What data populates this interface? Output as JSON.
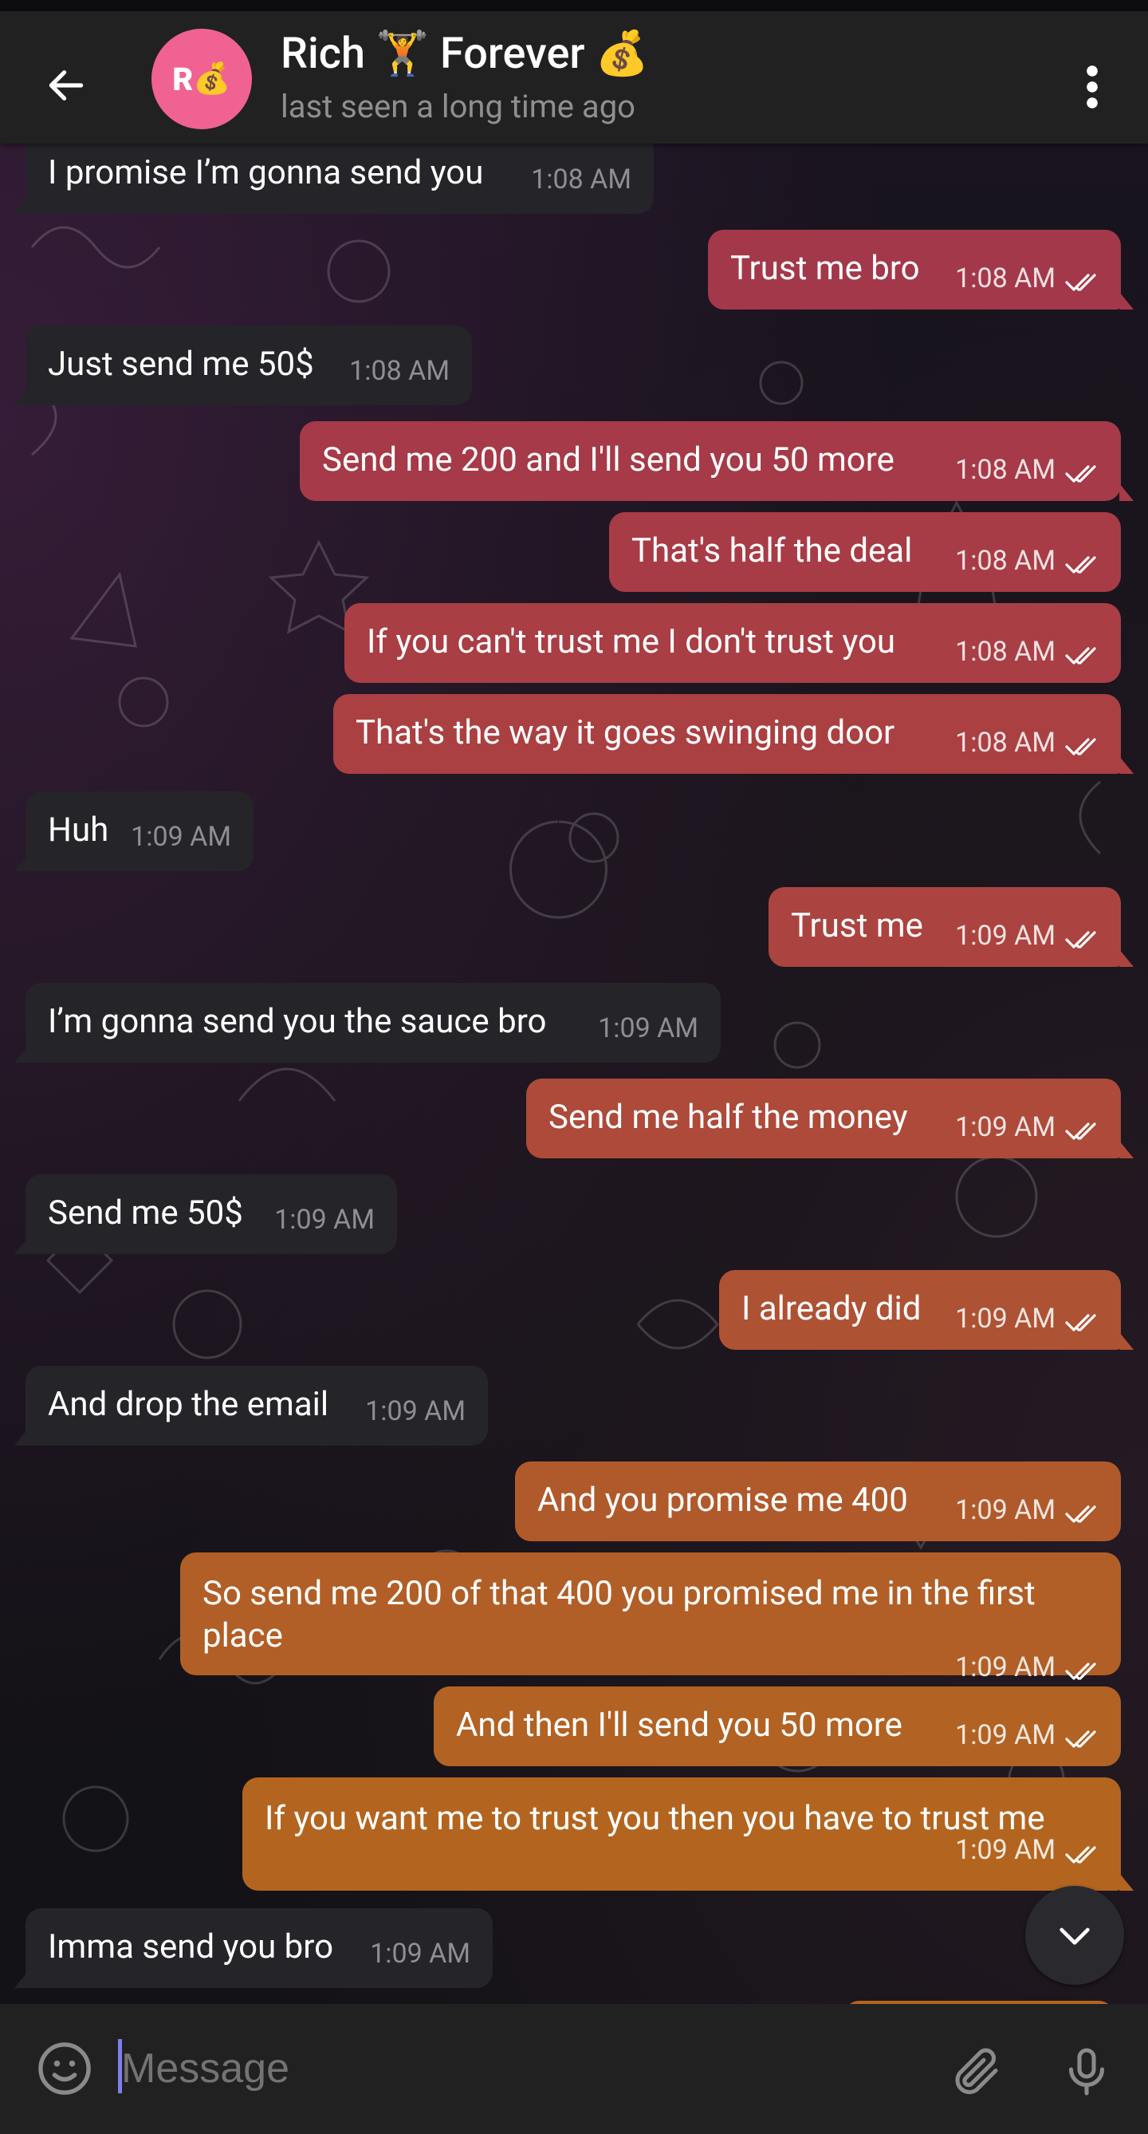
{
  "header": {
    "title": "Rich 🏋️ Forever 💰",
    "status": "last seen a long time ago",
    "avatar_initial": "R",
    "avatar_emoji": "💰",
    "avatar_color": "#f06292"
  },
  "icons": {
    "back": "arrow-left-icon",
    "menu": "more-vertical-icon",
    "emoji": "smiley-icon",
    "attach": "paperclip-icon",
    "mic": "microphone-icon",
    "scroll_down": "chevron-down-icon",
    "read_receipt": "double-check-icon"
  },
  "colors": {
    "incoming_bubble": "#252429",
    "outgoing_gradient_top": "#a33a4a",
    "outgoing_gradient_bottom": "#b5651e",
    "header_bg": "#212121"
  },
  "messages": [
    {
      "dir": "in",
      "text": "I promise I’m gonna send you",
      "time": "1:08 AM"
    },
    {
      "dir": "out",
      "text": "Trust me bro",
      "time": "1:08 AM"
    },
    {
      "dir": "in",
      "text": "Just send me 50$",
      "time": "1:08 AM"
    },
    {
      "dir": "out",
      "text": "Send me 200 and I'll send you 50 more",
      "time": "1:08 AM"
    },
    {
      "dir": "out",
      "text": "That's half the deal",
      "time": "1:08 AM"
    },
    {
      "dir": "out",
      "text": "If you can't trust me I don't trust you",
      "time": "1:08 AM"
    },
    {
      "dir": "out",
      "text": "That's the way it goes swinging door",
      "time": "1:08 AM"
    },
    {
      "dir": "in",
      "text": "Huh",
      "time": "1:09 AM"
    },
    {
      "dir": "out",
      "text": "Trust me",
      "time": "1:09 AM"
    },
    {
      "dir": "in",
      "text": "I’m gonna send you the sauce bro",
      "time": "1:09 AM"
    },
    {
      "dir": "out",
      "text": "Send me half the money",
      "time": "1:09 AM"
    },
    {
      "dir": "in",
      "text": "Send me 50$",
      "time": "1:09 AM"
    },
    {
      "dir": "out",
      "text": "I already did",
      "time": "1:09 AM"
    },
    {
      "dir": "in",
      "text": "And drop the email",
      "time": "1:09 AM"
    },
    {
      "dir": "out",
      "text": "And you promise me 400",
      "time": "1:09 AM"
    },
    {
      "dir": "out",
      "text": "So send me 200 of that 400 you promised me in the first place",
      "time": "1:09 AM"
    },
    {
      "dir": "out",
      "text": "And then I'll send you 50 more",
      "time": "1:09 AM"
    },
    {
      "dir": "out",
      "text": "If you want me to trust you then you have to trust me",
      "time": "1:09 AM"
    },
    {
      "dir": "in",
      "text": "Imma send you bro",
      "time": "1:09 AM"
    }
  ],
  "composer": {
    "placeholder": "Message"
  }
}
